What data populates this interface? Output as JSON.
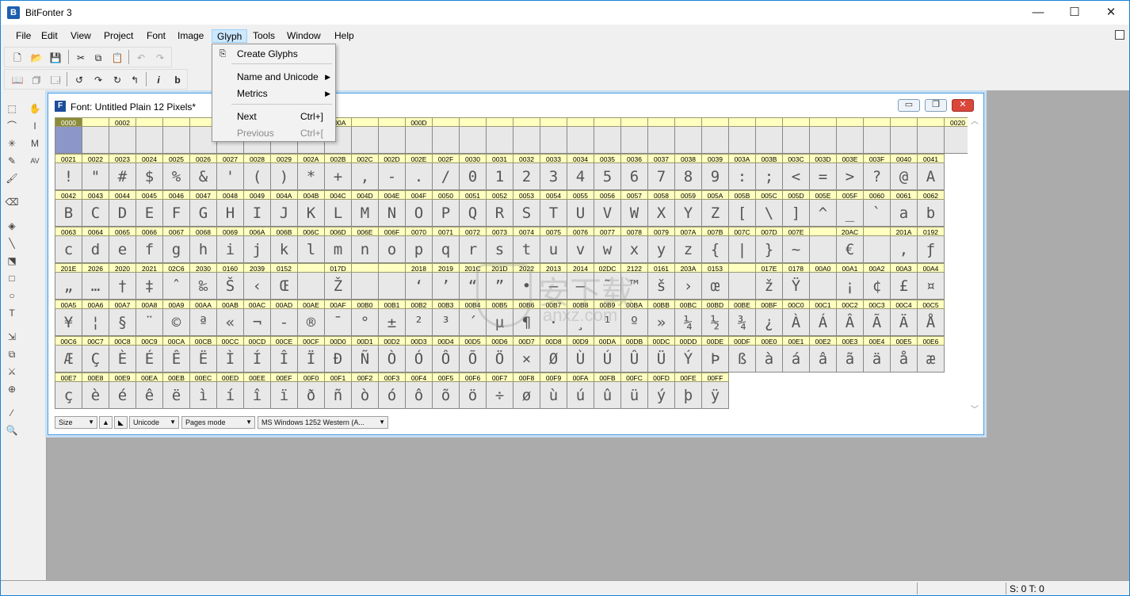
{
  "app": {
    "title": "BitFonter 3",
    "icon": "B"
  },
  "window_controls": {
    "minimize": "—",
    "maximize": "☐",
    "close": "✕"
  },
  "menubar": [
    "File",
    "Edit",
    "View",
    "Project",
    "Font",
    "Image",
    "Glyph",
    "Tools",
    "Window",
    "Help"
  ],
  "toolbar1": [
    {
      "name": "new-icon",
      "glyph": "🗋"
    },
    {
      "name": "open-icon",
      "glyph": "📂"
    },
    {
      "name": "save-icon",
      "glyph": "💾"
    },
    {
      "name": "cut-icon",
      "glyph": "✂"
    },
    {
      "name": "copy-icon",
      "glyph": "⧉"
    },
    {
      "name": "paste-icon",
      "glyph": "📋"
    },
    {
      "name": "undo-icon",
      "glyph": "↶"
    },
    {
      "name": "redo-icon",
      "glyph": "↷"
    }
  ],
  "toolbar2": [
    {
      "name": "book-icon",
      "glyph": "📖"
    },
    {
      "name": "stack-icon",
      "glyph": "🗇"
    },
    {
      "name": "window-icon",
      "glyph": "🗔"
    },
    {
      "name": "rotate-ccw-icon",
      "glyph": "↺"
    },
    {
      "name": "flip-icon",
      "glyph": "↷"
    },
    {
      "name": "rotate-cw-icon",
      "glyph": "↻"
    },
    {
      "name": "flip-back-icon",
      "glyph": "↰"
    },
    {
      "name": "italic-icon",
      "glyph": "i"
    },
    {
      "name": "bold-icon",
      "glyph": "b"
    }
  ],
  "left_tools": [
    {
      "name": "rect-select-icon",
      "glyph": "⬚"
    },
    {
      "name": "hand-icon",
      "glyph": "✋"
    },
    {
      "name": "lasso-icon",
      "glyph": "⌒"
    },
    {
      "name": "text-cursor-icon",
      "glyph": "I"
    },
    {
      "name": "magic-wand-icon",
      "glyph": "✳"
    },
    {
      "name": "metrics-icon",
      "glyph": "M"
    },
    {
      "name": "pencil-icon",
      "glyph": "✎"
    },
    {
      "name": "kerning-icon",
      "glyph": "AV"
    },
    {
      "name": "brush-icon",
      "glyph": "🖌"
    },
    {
      "name": "eraser-icon",
      "glyph": "⌫"
    },
    {
      "name": "fill-icon",
      "glyph": "◈"
    },
    {
      "name": "line-icon",
      "glyph": "╲"
    },
    {
      "name": "transform-icon",
      "glyph": "⬔"
    },
    {
      "name": "rectangle-icon",
      "glyph": "□"
    },
    {
      "name": "ellipse-icon",
      "glyph": "○"
    },
    {
      "name": "type-icon",
      "glyph": "T"
    },
    {
      "name": "move-icon",
      "glyph": "⇲"
    },
    {
      "name": "merge-icon",
      "glyph": "⧉"
    },
    {
      "name": "knife-icon",
      "glyph": "⚔"
    },
    {
      "name": "target-icon",
      "glyph": "⊕"
    },
    {
      "name": "eyedropper-icon",
      "glyph": "⁄"
    },
    {
      "name": "zoom-icon",
      "glyph": "🔍"
    }
  ],
  "font_window": {
    "title": "Font: Untitled Plain 12 Pixels*",
    "icon": "F",
    "controls": [
      "▭",
      "❐",
      "✕"
    ]
  },
  "glyph_rows": [
    [
      [
        "0000",
        ""
      ],
      [
        "",
        ""
      ],
      [
        "0002",
        ""
      ],
      [
        "",
        ""
      ],
      [
        "",
        ""
      ],
      [
        "",
        ""
      ],
      [
        "",
        ""
      ],
      [
        "",
        ""
      ],
      [
        "",
        ""
      ],
      [
        "",
        ""
      ],
      [
        "000A",
        ""
      ],
      [
        "",
        ""
      ],
      [
        "",
        ""
      ],
      [
        "000D",
        ""
      ],
      [
        "",
        ""
      ],
      [
        "",
        ""
      ],
      [
        "",
        ""
      ],
      [
        "",
        ""
      ],
      [
        "",
        ""
      ],
      [
        "",
        ""
      ],
      [
        "",
        ""
      ],
      [
        "",
        ""
      ],
      [
        "",
        ""
      ],
      [
        "",
        ""
      ],
      [
        "",
        ""
      ],
      [
        "",
        ""
      ],
      [
        "",
        ""
      ],
      [
        "",
        ""
      ],
      [
        "",
        ""
      ],
      [
        "",
        ""
      ],
      [
        "",
        ""
      ],
      [
        "",
        ""
      ],
      [
        "",
        ""
      ],
      [
        "0020",
        ""
      ]
    ],
    [
      [
        "0021",
        "!"
      ],
      [
        "0022",
        "\""
      ],
      [
        "0023",
        "#"
      ],
      [
        "0024",
        "$"
      ],
      [
        "0025",
        "%"
      ],
      [
        "0026",
        "&"
      ],
      [
        "0027",
        "'"
      ],
      [
        "0028",
        "("
      ],
      [
        "0029",
        ")"
      ],
      [
        "002A",
        "*"
      ],
      [
        "002B",
        "+"
      ],
      [
        "002C",
        ","
      ],
      [
        "002D",
        "-"
      ],
      [
        "002E",
        "."
      ],
      [
        "002F",
        "/"
      ],
      [
        "0030",
        "0"
      ],
      [
        "0031",
        "1"
      ],
      [
        "0032",
        "2"
      ],
      [
        "0033",
        "3"
      ],
      [
        "0034",
        "4"
      ],
      [
        "0035",
        "5"
      ],
      [
        "0036",
        "6"
      ],
      [
        "0037",
        "7"
      ],
      [
        "0038",
        "8"
      ],
      [
        "0039",
        "9"
      ],
      [
        "003A",
        ":"
      ],
      [
        "003B",
        ";"
      ],
      [
        "003C",
        "<"
      ],
      [
        "003D",
        "="
      ],
      [
        "003E",
        ">"
      ],
      [
        "003F",
        "?"
      ],
      [
        "0040",
        "@"
      ],
      [
        "0041",
        "A"
      ]
    ],
    [
      [
        "0042",
        "B"
      ],
      [
        "0043",
        "C"
      ],
      [
        "0044",
        "D"
      ],
      [
        "0045",
        "E"
      ],
      [
        "0046",
        "F"
      ],
      [
        "0047",
        "G"
      ],
      [
        "0048",
        "H"
      ],
      [
        "0049",
        "I"
      ],
      [
        "004A",
        "J"
      ],
      [
        "004B",
        "K"
      ],
      [
        "004C",
        "L"
      ],
      [
        "004D",
        "M"
      ],
      [
        "004E",
        "N"
      ],
      [
        "004F",
        "O"
      ],
      [
        "0050",
        "P"
      ],
      [
        "0051",
        "Q"
      ],
      [
        "0052",
        "R"
      ],
      [
        "0053",
        "S"
      ],
      [
        "0054",
        "T"
      ],
      [
        "0055",
        "U"
      ],
      [
        "0056",
        "V"
      ],
      [
        "0057",
        "W"
      ],
      [
        "0058",
        "X"
      ],
      [
        "0059",
        "Y"
      ],
      [
        "005A",
        "Z"
      ],
      [
        "005B",
        "["
      ],
      [
        "005C",
        "\\"
      ],
      [
        "005D",
        "]"
      ],
      [
        "005E",
        "^"
      ],
      [
        "005F",
        "_"
      ],
      [
        "0060",
        "`"
      ],
      [
        "0061",
        "a"
      ],
      [
        "0062",
        "b"
      ]
    ],
    [
      [
        "0063",
        "c"
      ],
      [
        "0064",
        "d"
      ],
      [
        "0065",
        "e"
      ],
      [
        "0066",
        "f"
      ],
      [
        "0067",
        "g"
      ],
      [
        "0068",
        "h"
      ],
      [
        "0069",
        "i"
      ],
      [
        "006A",
        "j"
      ],
      [
        "006B",
        "k"
      ],
      [
        "006C",
        "l"
      ],
      [
        "006D",
        "m"
      ],
      [
        "006E",
        "n"
      ],
      [
        "006F",
        "o"
      ],
      [
        "0070",
        "p"
      ],
      [
        "0071",
        "q"
      ],
      [
        "0072",
        "r"
      ],
      [
        "0073",
        "s"
      ],
      [
        "0074",
        "t"
      ],
      [
        "0075",
        "u"
      ],
      [
        "0076",
        "v"
      ],
      [
        "0077",
        "w"
      ],
      [
        "0078",
        "x"
      ],
      [
        "0079",
        "y"
      ],
      [
        "007A",
        "z"
      ],
      [
        "007B",
        "{"
      ],
      [
        "007C",
        "|"
      ],
      [
        "007D",
        "}"
      ],
      [
        "007E",
        "~"
      ],
      [
        "",
        ""
      ],
      [
        "20AC",
        "€"
      ],
      [
        "",
        ""
      ],
      [
        "201A",
        "‚"
      ],
      [
        "0192",
        "ƒ"
      ]
    ],
    [
      [
        "201E",
        "„"
      ],
      [
        "2026",
        "…"
      ],
      [
        "2020",
        "†"
      ],
      [
        "2021",
        "‡"
      ],
      [
        "02C6",
        "ˆ"
      ],
      [
        "2030",
        "‰"
      ],
      [
        "0160",
        "Š"
      ],
      [
        "2039",
        "‹"
      ],
      [
        "0152",
        "Œ"
      ],
      [
        "",
        ""
      ],
      [
        "017D",
        "Ž"
      ],
      [
        "",
        ""
      ],
      [
        "",
        ""
      ],
      [
        "2018",
        "‘"
      ],
      [
        "2019",
        "’"
      ],
      [
        "201C",
        "“"
      ],
      [
        "201D",
        "”"
      ],
      [
        "2022",
        "•"
      ],
      [
        "2013",
        "–"
      ],
      [
        "2014",
        "—"
      ],
      [
        "02DC",
        "˜"
      ],
      [
        "2122",
        "™"
      ],
      [
        "0161",
        "š"
      ],
      [
        "203A",
        "›"
      ],
      [
        "0153",
        "œ"
      ],
      [
        "",
        ""
      ],
      [
        "017E",
        "ž"
      ],
      [
        "0178",
        "Ÿ"
      ],
      [
        "00A0",
        ""
      ],
      [
        "00A1",
        "¡"
      ],
      [
        "00A2",
        "¢"
      ],
      [
        "00A3",
        "£"
      ],
      [
        "00A4",
        "¤"
      ]
    ],
    [
      [
        "00A5",
        "¥"
      ],
      [
        "00A6",
        "¦"
      ],
      [
        "00A7",
        "§"
      ],
      [
        "00A8",
        "¨"
      ],
      [
        "00A9",
        "©"
      ],
      [
        "00AA",
        "ª"
      ],
      [
        "00AB",
        "«"
      ],
      [
        "00AC",
        "¬"
      ],
      [
        "00AD",
        "-"
      ],
      [
        "00AE",
        "®"
      ],
      [
        "00AF",
        "¯"
      ],
      [
        "00B0",
        "°"
      ],
      [
        "00B1",
        "±"
      ],
      [
        "00B2",
        "²"
      ],
      [
        "00B3",
        "³"
      ],
      [
        "00B4",
        "´"
      ],
      [
        "00B5",
        "µ"
      ],
      [
        "00B6",
        "¶"
      ],
      [
        "00B7",
        "·"
      ],
      [
        "00B8",
        "¸"
      ],
      [
        "00B9",
        "¹"
      ],
      [
        "00BA",
        "º"
      ],
      [
        "00BB",
        "»"
      ],
      [
        "00BC",
        "¼"
      ],
      [
        "00BD",
        "½"
      ],
      [
        "00BE",
        "¾"
      ],
      [
        "00BF",
        "¿"
      ],
      [
        "00C0",
        "À"
      ],
      [
        "00C1",
        "Á"
      ],
      [
        "00C2",
        "Â"
      ],
      [
        "00C3",
        "Ã"
      ],
      [
        "00C4",
        "Ä"
      ],
      [
        "00C5",
        "Å"
      ]
    ],
    [
      [
        "00C6",
        "Æ"
      ],
      [
        "00C7",
        "Ç"
      ],
      [
        "00C8",
        "È"
      ],
      [
        "00C9",
        "É"
      ],
      [
        "00CA",
        "Ê"
      ],
      [
        "00CB",
        "Ë"
      ],
      [
        "00CC",
        "Ì"
      ],
      [
        "00CD",
        "Í"
      ],
      [
        "00CE",
        "Î"
      ],
      [
        "00CF",
        "Ï"
      ],
      [
        "00D0",
        "Ð"
      ],
      [
        "00D1",
        "Ñ"
      ],
      [
        "00D2",
        "Ò"
      ],
      [
        "00D3",
        "Ó"
      ],
      [
        "00D4",
        "Ô"
      ],
      [
        "00D5",
        "Õ"
      ],
      [
        "00D6",
        "Ö"
      ],
      [
        "00D7",
        "×"
      ],
      [
        "00D8",
        "Ø"
      ],
      [
        "00D9",
        "Ù"
      ],
      [
        "00DA",
        "Ú"
      ],
      [
        "00DB",
        "Û"
      ],
      [
        "00DC",
        "Ü"
      ],
      [
        "00DD",
        "Ý"
      ],
      [
        "00DE",
        "Þ"
      ],
      [
        "00DF",
        "ß"
      ],
      [
        "00E0",
        "à"
      ],
      [
        "00E1",
        "á"
      ],
      [
        "00E2",
        "â"
      ],
      [
        "00E3",
        "ã"
      ],
      [
        "00E4",
        "ä"
      ],
      [
        "00E5",
        "å"
      ],
      [
        "00E6",
        "æ"
      ]
    ],
    [
      [
        "00E7",
        "ç"
      ],
      [
        "00E8",
        "è"
      ],
      [
        "00E9",
        "é"
      ],
      [
        "00EA",
        "ê"
      ],
      [
        "00EB",
        "ë"
      ],
      [
        "00EC",
        "ì"
      ],
      [
        "00ED",
        "í"
      ],
      [
        "00EE",
        "î"
      ],
      [
        "00EF",
        "ï"
      ],
      [
        "00F0",
        "ð"
      ],
      [
        "00F1",
        "ñ"
      ],
      [
        "00F2",
        "ò"
      ],
      [
        "00F3",
        "ó"
      ],
      [
        "00F4",
        "ô"
      ],
      [
        "00F5",
        "õ"
      ],
      [
        "00F6",
        "ö"
      ],
      [
        "00F7",
        "÷"
      ],
      [
        "00F8",
        "ø"
      ],
      [
        "00F9",
        "ù"
      ],
      [
        "00FA",
        "ú"
      ],
      [
        "00FB",
        "û"
      ],
      [
        "00FC",
        "ü"
      ],
      [
        "00FD",
        "ý"
      ],
      [
        "00FE",
        "þ"
      ],
      [
        "00FF",
        "ÿ"
      ]
    ]
  ],
  "selected_glyph": "0000",
  "font_status": {
    "size": "Size",
    "unicode": "Unicode",
    "pages_mode": "Pages mode",
    "encoding": "MS Windows 1252 Western (A..."
  },
  "glyph_menu": {
    "items": [
      {
        "label": "Create Glyphs",
        "shortcut": "",
        "submenu": false,
        "disabled": false
      },
      {
        "label": "Name and Unicode",
        "shortcut": "",
        "submenu": true,
        "disabled": false
      },
      {
        "label": "Metrics",
        "shortcut": "",
        "submenu": true,
        "disabled": false
      },
      {
        "label": "Next",
        "shortcut": "Ctrl+]",
        "submenu": false,
        "disabled": false
      },
      {
        "label": "Previous",
        "shortcut": "Ctrl+[",
        "submenu": false,
        "disabled": true
      }
    ]
  },
  "watermark": {
    "cn": "安下载",
    "en": "anxz.com"
  },
  "statusbar": {
    "text": "S: 0 T: 0"
  },
  "colors": {
    "header_bg": "#ffffc0",
    "selected_header": "#8b8b3a",
    "selected_cell": "#8c96c8",
    "cell_bg": "#e8e8e8",
    "workspace": "#ababab",
    "menu_highlight": "#cce8ff"
  }
}
